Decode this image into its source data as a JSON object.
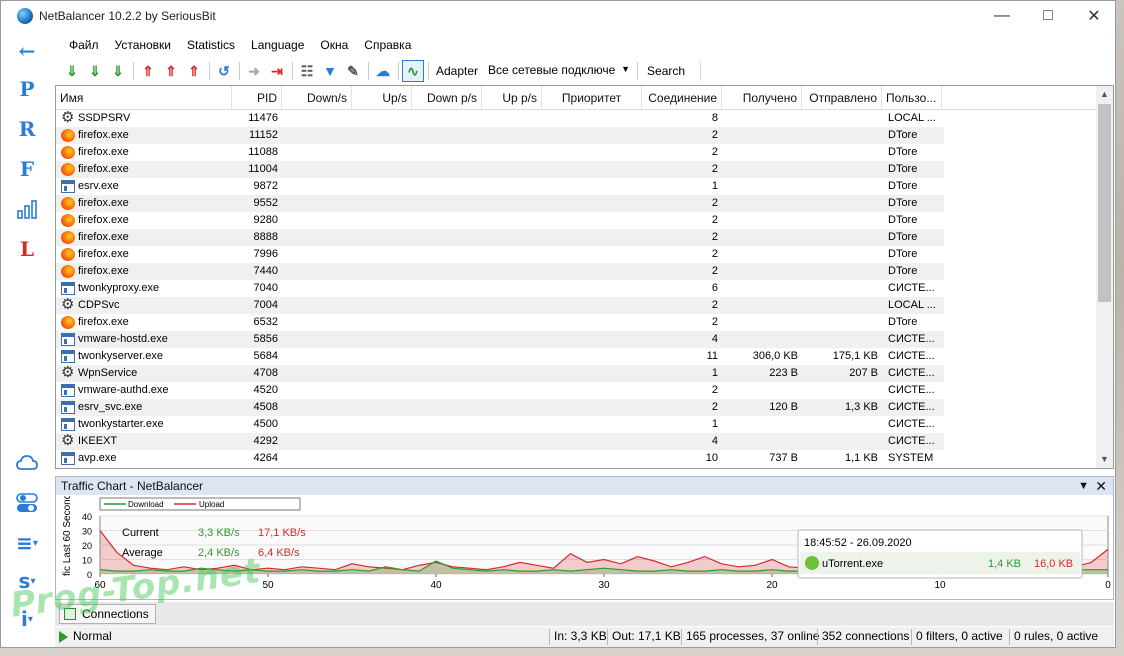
{
  "window": {
    "title": "NetBalancer 10.2.2 by SeriousBit"
  },
  "sidebar": {
    "items": [
      {
        "label": "←",
        "color": "#2a7cd6"
      },
      {
        "label": "P",
        "color": "#2a7cd6"
      },
      {
        "label": "R",
        "color": "#2a7cd6"
      },
      {
        "label": "F",
        "color": "#2a7cd6"
      },
      {
        "label": "",
        "icon": "bar-chart-icon",
        "color": "#2a7cd6"
      },
      {
        "label": "L",
        "color": "#d62a2a"
      }
    ],
    "bottom_items": [
      {
        "label": "",
        "icon": "cloud-icon"
      },
      {
        "label": "",
        "icon": "toggle-icon"
      },
      {
        "label": "≡",
        "icon": "menu-icon"
      },
      {
        "label": "s",
        "icon": "s-menu-icon"
      },
      {
        "label": "i",
        "icon": "info-icon"
      }
    ]
  },
  "menu": [
    "Файл",
    "Установки",
    "Statistics",
    "Language",
    "Окна",
    "Справка"
  ],
  "toolbar": {
    "adapter_label": "Adapter",
    "adapter_value": "Все сетевые подключе",
    "search_label": "Search"
  },
  "columns": [
    "Имя",
    "PID",
    "Down/s",
    "Up/s",
    "Down p/s",
    "Up p/s",
    "Приоритет",
    "Соединение",
    "Получено",
    "Отправлено",
    "Пользо..."
  ],
  "rows": [
    {
      "icon": "gear",
      "name": "SSDPSRV",
      "pid": "11476",
      "conn": "8",
      "recv": "",
      "sent": "",
      "user": "LOCAL ..."
    },
    {
      "icon": "firefox",
      "name": "firefox.exe",
      "pid": "11152",
      "conn": "2",
      "recv": "",
      "sent": "",
      "user": "DTore"
    },
    {
      "icon": "firefox",
      "name": "firefox.exe",
      "pid": "11088",
      "conn": "2",
      "recv": "",
      "sent": "",
      "user": "DTore"
    },
    {
      "icon": "firefox",
      "name": "firefox.exe",
      "pid": "11004",
      "conn": "2",
      "recv": "",
      "sent": "",
      "user": "DTore"
    },
    {
      "icon": "exe",
      "name": "esrv.exe",
      "pid": "9872",
      "conn": "1",
      "recv": "",
      "sent": "",
      "user": "DTore"
    },
    {
      "icon": "firefox",
      "name": "firefox.exe",
      "pid": "9552",
      "conn": "2",
      "recv": "",
      "sent": "",
      "user": "DTore"
    },
    {
      "icon": "firefox",
      "name": "firefox.exe",
      "pid": "9280",
      "conn": "2",
      "recv": "",
      "sent": "",
      "user": "DTore"
    },
    {
      "icon": "firefox",
      "name": "firefox.exe",
      "pid": "8888",
      "conn": "2",
      "recv": "",
      "sent": "",
      "user": "DTore"
    },
    {
      "icon": "firefox",
      "name": "firefox.exe",
      "pid": "7996",
      "conn": "2",
      "recv": "",
      "sent": "",
      "user": "DTore"
    },
    {
      "icon": "firefox",
      "name": "firefox.exe",
      "pid": "7440",
      "conn": "2",
      "recv": "",
      "sent": "",
      "user": "DTore"
    },
    {
      "icon": "exe",
      "name": "twonkyproxy.exe",
      "pid": "7040",
      "conn": "6",
      "recv": "",
      "sent": "",
      "user": "СИСТЕ..."
    },
    {
      "icon": "gear",
      "name": "CDPSvc",
      "pid": "7004",
      "conn": "2",
      "recv": "",
      "sent": "",
      "user": "LOCAL ..."
    },
    {
      "icon": "firefox",
      "name": "firefox.exe",
      "pid": "6532",
      "conn": "2",
      "recv": "",
      "sent": "",
      "user": "DTore"
    },
    {
      "icon": "exe",
      "name": "vmware-hostd.exe",
      "pid": "5856",
      "conn": "4",
      "recv": "",
      "sent": "",
      "user": "СИСТЕ..."
    },
    {
      "icon": "exe",
      "name": "twonkyserver.exe",
      "pid": "5684",
      "conn": "11",
      "recv": "306,0 KB",
      "sent": "175,1 KB",
      "user": "СИСТЕ..."
    },
    {
      "icon": "gear",
      "name": "WpnService",
      "pid": "4708",
      "conn": "1",
      "recv": "223 B",
      "sent": "207 B",
      "user": "СИСТЕ..."
    },
    {
      "icon": "exe",
      "name": "vmware-authd.exe",
      "pid": "4520",
      "conn": "2",
      "recv": "",
      "sent": "",
      "user": "СИСТЕ..."
    },
    {
      "icon": "exe",
      "name": "esrv_svc.exe",
      "pid": "4508",
      "conn": "2",
      "recv": "120 B",
      "sent": "1,3 KB",
      "user": "СИСТЕ..."
    },
    {
      "icon": "exe",
      "name": "twonkystarter.exe",
      "pid": "4500",
      "conn": "1",
      "recv": "",
      "sent": "",
      "user": "СИСТЕ..."
    },
    {
      "icon": "gear",
      "name": "IKEEXT",
      "pid": "4292",
      "conn": "4",
      "recv": "",
      "sent": "",
      "user": "СИСТЕ..."
    },
    {
      "icon": "exe",
      "name": "avp.exe",
      "pid": "4264",
      "conn": "10",
      "recv": "737 B",
      "sent": "1,1 KB",
      "user": "SYSTEM"
    }
  ],
  "chart_panel": {
    "title": "Traffic Chart - NetBalancer",
    "legend": {
      "download": "Download",
      "upload": "Upload"
    },
    "current_label": "Current",
    "current_down": "3,3 KB/s",
    "current_up": "17,1 KB/s",
    "average_label": "Average",
    "average_down": "2,4 KB/s",
    "average_up": "6,4 KB/s",
    "y_axis_label": "fic Last 60 Seconds,",
    "tooltip": {
      "time": "18:45:52 - 26.09.2020",
      "app": "uTorrent.exe",
      "down": "1,4 KB",
      "up": "16,0 KB"
    }
  },
  "chart_data": {
    "type": "area",
    "xlabel": "",
    "ylabel": "fic Last 60 Seconds,",
    "xlim": [
      60,
      0
    ],
    "ylim": [
      0,
      40
    ],
    "x_ticks": [
      60,
      50,
      40,
      30,
      20,
      10,
      0
    ],
    "y_ticks": [
      0,
      10,
      20,
      30,
      40
    ],
    "x": [
      60,
      59,
      58,
      57,
      56,
      55,
      54,
      53,
      52,
      51,
      50,
      49,
      48,
      47,
      46,
      45,
      44,
      43,
      42,
      41,
      40,
      39,
      38,
      37,
      36,
      35,
      34,
      33,
      32,
      31,
      30,
      29,
      28,
      27,
      26,
      25,
      24,
      23,
      22,
      21,
      20,
      19,
      18,
      17,
      16,
      15,
      14,
      13,
      12,
      11,
      10,
      9,
      8,
      7,
      6,
      5,
      4,
      3,
      2,
      1,
      0
    ],
    "series": [
      {
        "name": "Download",
        "color": "#2e9a2e",
        "values": [
          3,
          2,
          2,
          3,
          2,
          2,
          4,
          3,
          2,
          3,
          2,
          2,
          3,
          2,
          2,
          3,
          2,
          5,
          3,
          2,
          9,
          4,
          3,
          2,
          3,
          2,
          2,
          3,
          2,
          3,
          4,
          3,
          2,
          2,
          3,
          2,
          2,
          3,
          2,
          2,
          3,
          2,
          2,
          3,
          2,
          2,
          3,
          2,
          4,
          3,
          2,
          2,
          3,
          2,
          2,
          3,
          2,
          2,
          3,
          3,
          3
        ]
      },
      {
        "name": "Upload",
        "color": "#d62a2a",
        "values": [
          30,
          15,
          6,
          4,
          3,
          5,
          3,
          4,
          6,
          3,
          4,
          3,
          5,
          4,
          3,
          7,
          5,
          4,
          3,
          6,
          8,
          5,
          4,
          3,
          5,
          8,
          6,
          4,
          14,
          8,
          10,
          7,
          12,
          9,
          5,
          8,
          12,
          7,
          5,
          6,
          10,
          5,
          4,
          6,
          8,
          5,
          3,
          6,
          5,
          4,
          7,
          5,
          4,
          3,
          5,
          4,
          3,
          4,
          5,
          8,
          17
        ]
      }
    ]
  },
  "tabs": [
    {
      "label": "Connections"
    }
  ],
  "status": {
    "mode": "Normal",
    "in": "In: 3,3 KB",
    "out": "Out: 17,1 KB",
    "processes": "165 processes, 37 online",
    "connections": "352 connections",
    "filters": "0 filters, 0 active",
    "rules": "0 rules, 0 active"
  },
  "watermark": "Prog-Top.net"
}
